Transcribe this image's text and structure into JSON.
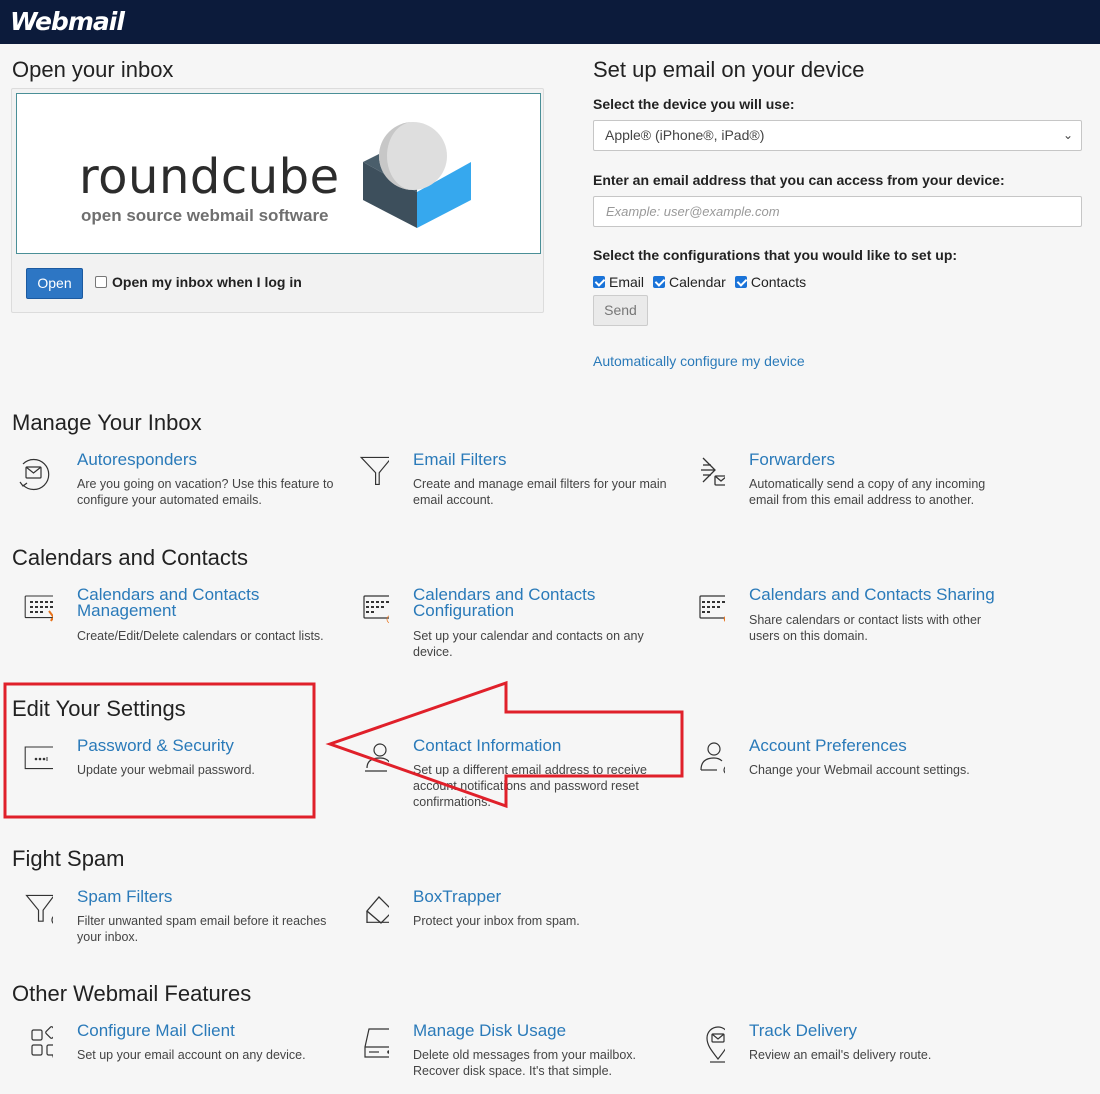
{
  "brand": "Webmail",
  "inbox": {
    "title": "Open your inbox",
    "logo_word": "roundcube",
    "logo_sub": "open source webmail software",
    "open_label": "Open",
    "auto_open_label": "Open my inbox when I log in"
  },
  "device": {
    "title": "Set up email on your device",
    "select_label": "Select the device you will use:",
    "select_value": "Apple® (iPhone®, iPad®)",
    "email_label": "Enter an email address that you can access from your device:",
    "email_placeholder": "Example: user@example.com",
    "config_label": "Select the configurations that you would like to set up:",
    "config_options": [
      "Email",
      "Calendar",
      "Contacts"
    ],
    "send_label": "Send",
    "auto_link": "Automatically configure my device"
  },
  "sections": {
    "manage": {
      "title": "Manage Your Inbox",
      "items": [
        {
          "title": "Autoresponders",
          "desc": "Are you going on vacation? Use this feature to configure your automated emails.",
          "icon": "autoresponder-icon"
        },
        {
          "title": "Email Filters",
          "desc": "Create and manage email filters for your main email account.",
          "icon": "filter-icon"
        },
        {
          "title": "Forwarders",
          "desc": "Automatically send a copy of any incoming email from this email address to another.",
          "icon": "forward-icon"
        }
      ]
    },
    "calendars": {
      "title": "Calendars and Contacts",
      "items": [
        {
          "title": "Calendars and Contacts Management",
          "desc": "Create/Edit/Delete calendars or contact lists.",
          "icon": "calendar-manage-icon"
        },
        {
          "title": "Calendars and Contacts Configuration",
          "desc": "Set up your calendar and contacts on any device.",
          "icon": "calendar-config-icon"
        },
        {
          "title": "Calendars and Contacts Sharing",
          "desc": "Share calendars or contact lists with other users on this domain.",
          "icon": "calendar-share-icon"
        }
      ]
    },
    "settings": {
      "title": "Edit Your Settings",
      "items": [
        {
          "title": "Password & Security",
          "desc": "Update your webmail password.",
          "icon": "password-icon"
        },
        {
          "title": "Contact Information",
          "desc": "Set up a different email address to receive account notifications and password reset confirmations.",
          "icon": "contact-icon"
        },
        {
          "title": "Account Preferences",
          "desc": "Change your Webmail account settings.",
          "icon": "account-prefs-icon"
        }
      ]
    },
    "spam": {
      "title": "Fight Spam",
      "items": [
        {
          "title": "Spam Filters",
          "desc": "Filter unwanted spam email before it reaches your inbox.",
          "icon": "spam-filter-icon"
        },
        {
          "title": "BoxTrapper",
          "desc": "Protect your inbox from spam.",
          "icon": "boxtrapper-icon"
        }
      ]
    },
    "other": {
      "title": "Other Webmail Features",
      "items": [
        {
          "title": "Configure Mail Client",
          "desc": "Set up your email account on any device.",
          "icon": "mail-client-icon"
        },
        {
          "title": "Manage Disk Usage",
          "desc": "Delete old messages from your mailbox. Recover disk space. It's that simple.",
          "icon": "disk-icon"
        },
        {
          "title": "Track Delivery",
          "desc": "Review an email's delivery route.",
          "icon": "track-icon"
        }
      ]
    }
  },
  "colors": {
    "topbar": "#0c1b3b",
    "link": "#2a7ab9",
    "primary_button": "#2d76c4",
    "annotation": "#e0202a"
  }
}
